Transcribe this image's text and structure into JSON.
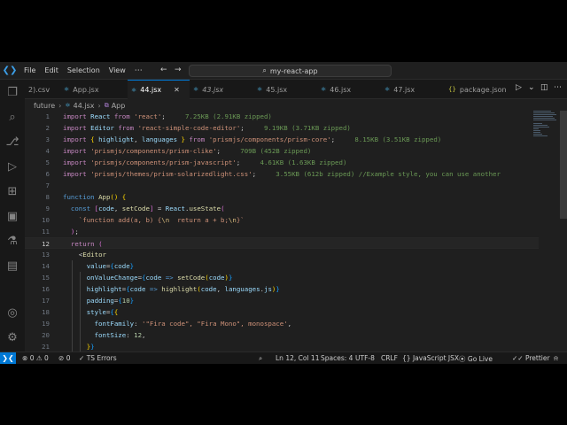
{
  "menu": [
    "File",
    "Edit",
    "Selection",
    "View"
  ],
  "command_center": {
    "label": "my-react-app"
  },
  "tabs": [
    {
      "label": "2).csv",
      "type": "csv",
      "active": false
    },
    {
      "label": "App.jsx",
      "type": "jsx",
      "active": false
    },
    {
      "label": "44.jsx",
      "type": "jsx",
      "active": true
    },
    {
      "label": "43.jsx",
      "type": "jsx",
      "active": false,
      "preview": true
    },
    {
      "label": "45.jsx",
      "type": "jsx",
      "active": false
    },
    {
      "label": "46.jsx",
      "type": "jsx",
      "active": false
    },
    {
      "label": "47.jsx",
      "type": "jsx",
      "active": false
    },
    {
      "label": "package.json",
      "type": "json",
      "active": false
    }
  ],
  "breadcrumb": {
    "folder": "future",
    "file": "44.jsx",
    "symbol": "App"
  },
  "editor": {
    "current_line": 12
  },
  "status": {
    "errors": "0",
    "warnings": "0",
    "ports": "0",
    "ts_errors": "TS Errors",
    "position": "Ln 12, Col 11",
    "spaces": "Spaces: 4",
    "encoding": "UTF-8",
    "eol": "CRLF",
    "language": "JavaScript JSX",
    "golive": "Go Live",
    "prettier": "Prettier"
  },
  "colors": {
    "accent": "#0078d4",
    "editor_bg": "#1f1f1f",
    "chrome_bg": "#181818"
  }
}
